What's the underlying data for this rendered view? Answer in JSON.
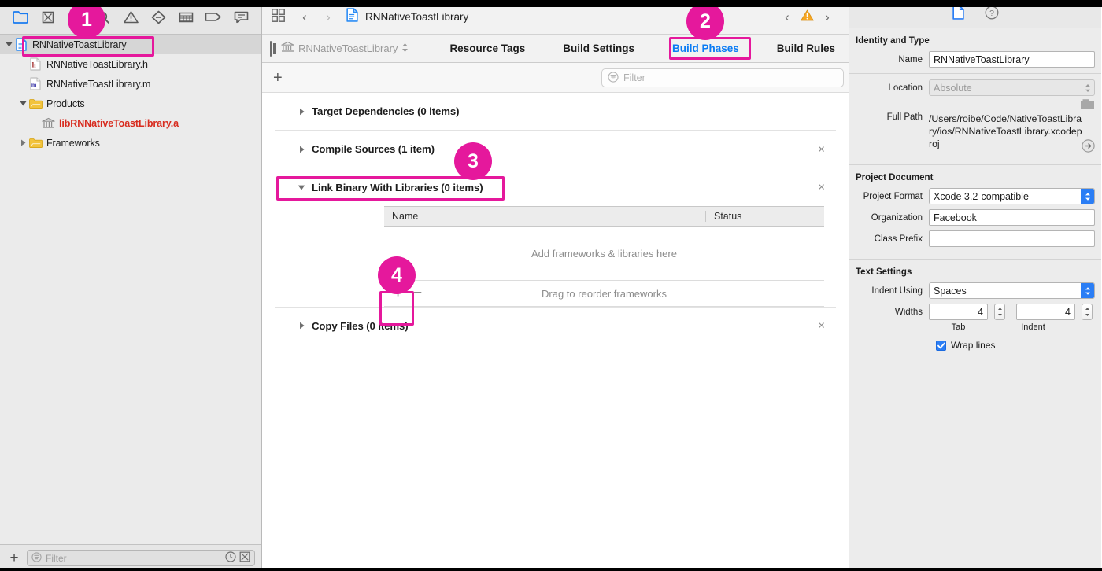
{
  "navigator": {
    "toolbar_icons": [
      {
        "name": "project-navigator-icon",
        "selected": true
      },
      {
        "name": "source-control-navigator-icon",
        "selected": false
      },
      {
        "name": "symbol-navigator-icon",
        "selected": false
      },
      {
        "name": "find-navigator-icon",
        "selected": false
      },
      {
        "name": "issue-navigator-icon",
        "selected": false
      },
      {
        "name": "test-navigator-icon",
        "selected": false
      },
      {
        "name": "debug-navigator-icon",
        "selected": false
      },
      {
        "name": "breakpoint-navigator-icon",
        "selected": false
      },
      {
        "name": "report-navigator-icon",
        "selected": false
      }
    ],
    "tree": [
      {
        "label": "RNNativeToastLibrary",
        "icon": "xcode-project-icon",
        "indent": 0,
        "disclosure": "open",
        "selected": true,
        "kind": "project"
      },
      {
        "label": "RNNativeToastLibrary.h",
        "icon": "header-file-icon",
        "indent": 1,
        "disclosure": "none",
        "selected": false,
        "kind": "file"
      },
      {
        "label": "RNNativeToastLibrary.m",
        "icon": "objc-file-icon",
        "indent": 1,
        "disclosure": "none",
        "selected": false,
        "kind": "file"
      },
      {
        "label": "Products",
        "icon": "folder-icon",
        "indent": 1,
        "disclosure": "open",
        "selected": false,
        "kind": "group"
      },
      {
        "label": "libRNNativeToastLibrary.a",
        "icon": "library-icon",
        "indent": 2,
        "disclosure": "none",
        "selected": false,
        "kind": "product"
      },
      {
        "label": "Frameworks",
        "icon": "folder-icon",
        "indent": 1,
        "disclosure": "closed",
        "selected": false,
        "kind": "group"
      }
    ],
    "filter": {
      "placeholder": "Filter",
      "value": "",
      "add_label": "+",
      "recent_icon": "clock-icon",
      "source-control-icon": "source-control-filter-icon"
    }
  },
  "editor": {
    "jumpbar": {
      "grid_icon": "related-items-icon",
      "back_label": "‹",
      "forward_label": "›",
      "doc_icon": "xcode-project-icon",
      "title": "RNNativeToastLibrary",
      "issue_prev": "‹",
      "issue_icon": "warning-triangle-icon",
      "issue_next": "›"
    },
    "targetbar": {
      "sidebar_toggle_icon": "target-list-toggle-icon",
      "target_icon": "library-icon",
      "target_name": "RNNativeToastLibrary",
      "target_chevron": "chevron-updown-icon",
      "tabs": [
        {
          "label": "Resource Tags",
          "active": false
        },
        {
          "label": "Build Settings",
          "active": false
        },
        {
          "label": "Build Phases",
          "active": true
        },
        {
          "label": "Build Rules",
          "active": false
        }
      ]
    },
    "phasesbar": {
      "add_label": "+",
      "filter_placeholder": "Filter",
      "filter_value": "",
      "filter_icon": "filter-icon"
    },
    "phases": [
      {
        "title": "Target Dependencies (0 items)",
        "expanded": false,
        "closable": false
      },
      {
        "title": "Compile Sources (1 item)",
        "expanded": false,
        "closable": true
      },
      {
        "title": "Link Binary With Libraries (0 items)",
        "expanded": true,
        "closable": true
      },
      {
        "title": "Copy Files (0 items)",
        "expanded": false,
        "closable": true
      }
    ],
    "link_binary": {
      "columns": [
        "Name",
        "Status"
      ],
      "empty_message": "Add frameworks & libraries here",
      "reorder_hint": "Drag to reorder frameworks",
      "add_label": "+",
      "remove_label": "−"
    }
  },
  "inspector": {
    "tabs": [
      {
        "name": "file-inspector-icon",
        "active": true
      },
      {
        "name": "quick-help-icon",
        "active": false
      }
    ],
    "identity": {
      "title": "Identity and Type",
      "name_label": "Name",
      "name_value": "RNNativeToastLibrary",
      "location_label": "Location",
      "location_value": "Absolute",
      "folder_icon": "choose-folder-icon",
      "fullpath_label": "Full Path",
      "fullpath_value": "/Users/roibe/Code/NativeToastLibrary/ios/RNNativeToastLibrary.xcodeproj",
      "reveal_icon": "reveal-in-finder-icon"
    },
    "project_document": {
      "title": "Project Document",
      "format_label": "Project Format",
      "format_value": "Xcode 3.2-compatible",
      "organization_label": "Organization",
      "organization_value": "Facebook",
      "class_prefix_label": "Class Prefix",
      "class_prefix_value": ""
    },
    "text_settings": {
      "title": "Text Settings",
      "indent_using_label": "Indent Using",
      "indent_using_value": "Spaces",
      "widths_label": "Widths",
      "tab_value": "4",
      "tab_caption": "Tab",
      "indent_value": "4",
      "indent_caption": "Indent",
      "wrap_lines_label": "Wrap lines",
      "wrap_lines_checked": true
    }
  },
  "annotations": [
    {
      "number": "1",
      "target": "project-file-in-navigator"
    },
    {
      "number": "2",
      "target": "build-phases-tab"
    },
    {
      "number": "3",
      "target": "link-binary-with-libraries-phase"
    },
    {
      "number": "4",
      "target": "add-framework-button"
    }
  ],
  "colors": {
    "annotation": "#e5189c",
    "accent_blue": "#0a7bf4",
    "product_red": "#d82b1e",
    "warning_orange": "#f5a623"
  }
}
